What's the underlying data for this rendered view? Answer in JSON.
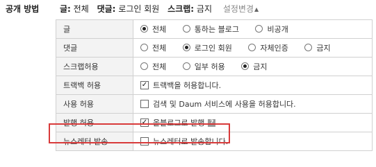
{
  "section_title": "공개 방법",
  "summary": {
    "post_label": "글:",
    "post_value": "전체",
    "comment_label": "댓글:",
    "comment_value": "로그인 회원",
    "scrap_label": "스크랩:",
    "scrap_value": "금지",
    "settings_link": "설정변경",
    "caret": "▲"
  },
  "rows": [
    {
      "label": "글",
      "options": [
        {
          "text": "전체",
          "checked": true
        },
        {
          "text": "통하는 블로그",
          "checked": false
        },
        {
          "text": "비공개",
          "checked": false
        }
      ]
    },
    {
      "label": "댓글",
      "options": [
        {
          "text": "전체",
          "checked": false
        },
        {
          "text": "로그인 회원",
          "checked": true
        },
        {
          "text": "자체인증",
          "checked": false
        },
        {
          "text": "금지",
          "checked": false
        }
      ]
    },
    {
      "label": "스크랩허용",
      "options": [
        {
          "text": "전체",
          "checked": false
        },
        {
          "text": "일부 허용",
          "checked": false
        },
        {
          "text": "금지",
          "checked": true
        }
      ]
    },
    {
      "label": "트랙백 허용",
      "checkbox": {
        "text": "트랙백을 허용합니다.",
        "checked": true
      }
    },
    {
      "label": "사용 허용",
      "checkbox": {
        "text": "검색 및 Daum 서비스에 사용을 허용합니다.",
        "checked": false
      }
    },
    {
      "label": "발행 허용",
      "checkbox": {
        "text": "올블로그로 발행",
        "checked": true
      },
      "help": "?"
    },
    {
      "label": "뉴스레터 발송",
      "checkbox": {
        "text": "뉴스레터로 발송합니다.",
        "checked": false
      }
    }
  ],
  "colors": {
    "highlight": "#d83a3a",
    "label_bg": "#f3f3f3",
    "border": "#d0d0d0"
  }
}
